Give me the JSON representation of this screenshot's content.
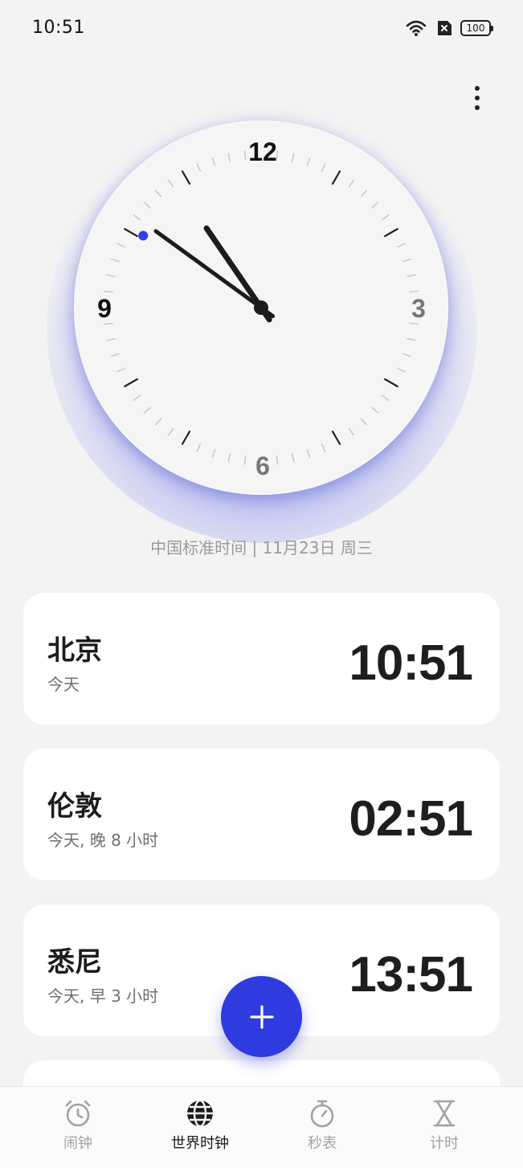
{
  "status_bar": {
    "time": "10:51",
    "battery": "100",
    "icons": [
      "wifi-icon",
      "sim-off-icon",
      "battery-icon"
    ]
  },
  "header": {
    "more_icon": "more-vertical-icon"
  },
  "clock": {
    "numerals": [
      "12",
      "3",
      "6",
      "9"
    ],
    "hour": 10,
    "minute": 51,
    "second_dot_color": "#3340e0",
    "glow_color": "#4254eb"
  },
  "date_line": "中国标准时间 | 11月23日  周三",
  "cities": [
    {
      "name": "北京",
      "sub": "今天",
      "time": "10:51"
    },
    {
      "name": "伦敦",
      "sub": "今天, 晚 8 小时",
      "time": "02:51"
    },
    {
      "name": "悉尼",
      "sub": "今天, 早 3 小时",
      "time": "13:51"
    }
  ],
  "fab": {
    "icon": "plus-icon",
    "color": "#2d3bdf"
  },
  "nav": [
    {
      "label": "闹钟",
      "icon": "alarm-icon",
      "active": false
    },
    {
      "label": "世界时钟",
      "icon": "globe-icon",
      "active": true
    },
    {
      "label": "秒表",
      "icon": "stopwatch-icon",
      "active": false
    },
    {
      "label": "计时",
      "icon": "hourglass-icon",
      "active": false
    }
  ]
}
